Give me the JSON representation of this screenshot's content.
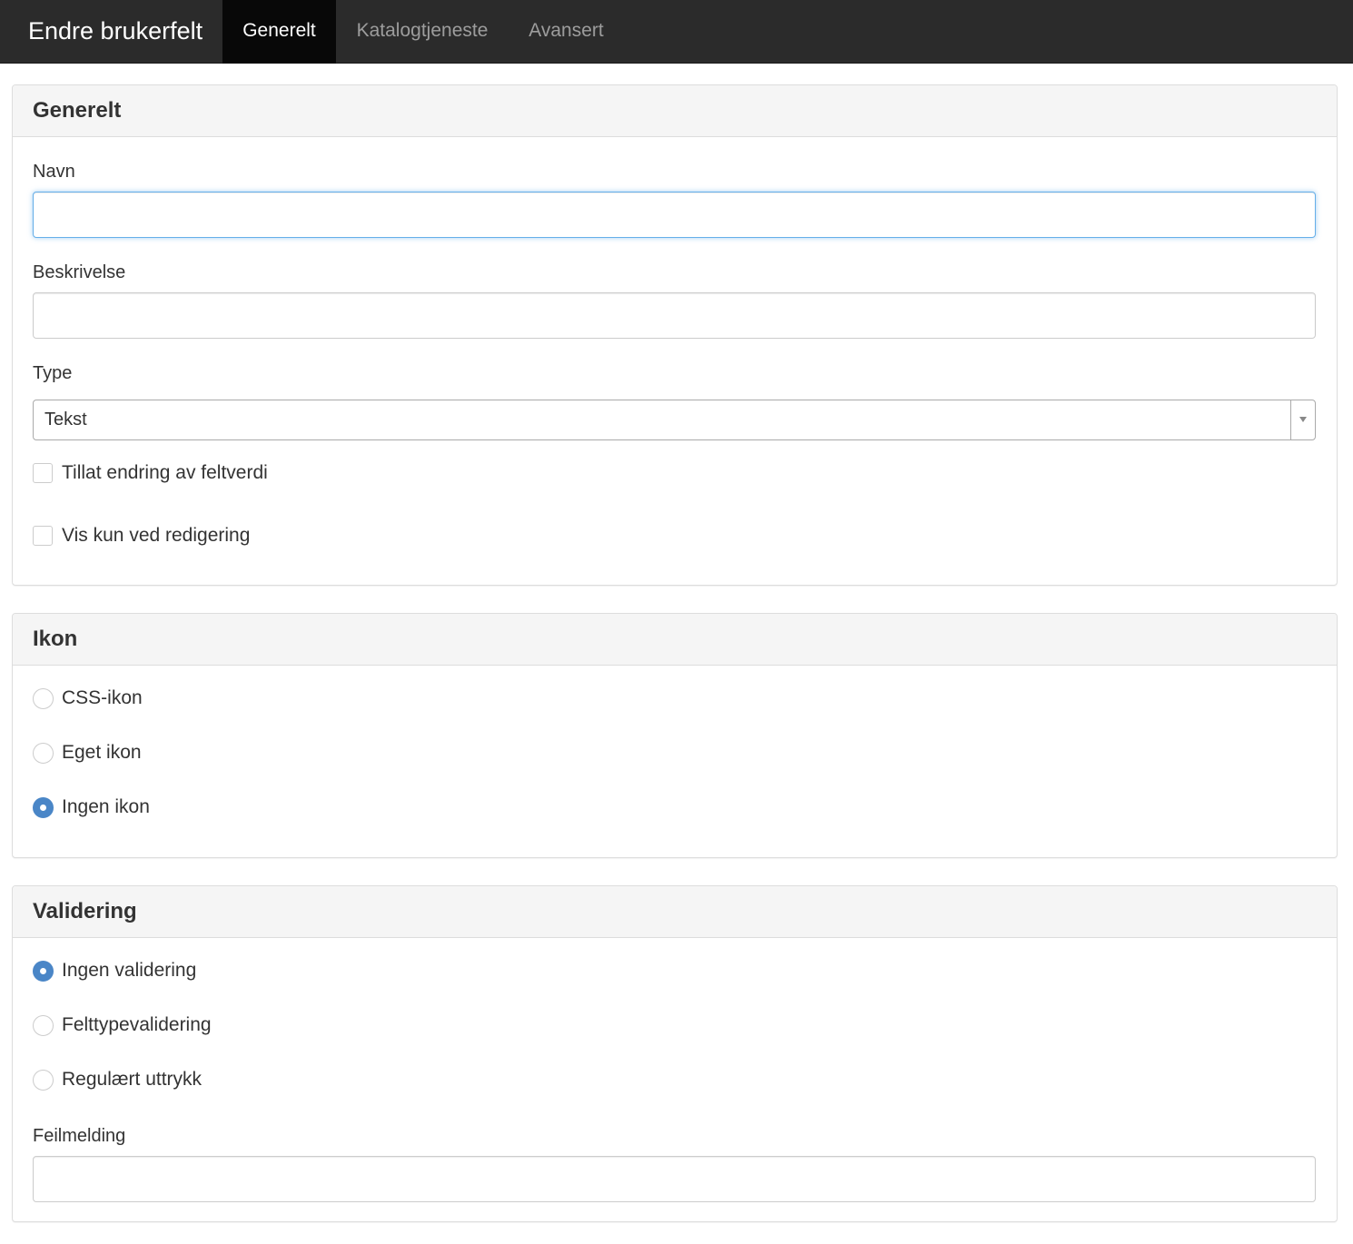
{
  "navbar": {
    "brand": "Endre brukerfelt",
    "tabs": [
      {
        "label": "Generelt",
        "active": true
      },
      {
        "label": "Katalogtjeneste",
        "active": false
      },
      {
        "label": "Avansert",
        "active": false
      }
    ]
  },
  "general": {
    "heading": "Generelt",
    "name_label": "Navn",
    "name_value": "",
    "description_label": "Beskrivelse",
    "description_value": "",
    "type_label": "Type",
    "type_value": "Tekst",
    "allow_edit_label": "Tillat endring av feltverdi",
    "allow_edit_checked": false,
    "show_only_edit_label": "Vis kun ved redigering",
    "show_only_edit_checked": false
  },
  "icon": {
    "heading": "Ikon",
    "options": [
      {
        "label": "CSS-ikon",
        "checked": false
      },
      {
        "label": "Eget ikon",
        "checked": false
      },
      {
        "label": "Ingen ikon",
        "checked": true
      }
    ]
  },
  "validation": {
    "heading": "Validering",
    "options": [
      {
        "label": "Ingen validering",
        "checked": true
      },
      {
        "label": "Felttypevalidering",
        "checked": false
      },
      {
        "label": "Regulært uttrykk",
        "checked": false
      }
    ],
    "error_label": "Feilmelding",
    "error_value": ""
  },
  "colors": {
    "navbar_bg": "#2b2b2b",
    "active_tab_bg": "#080808",
    "radio_checked": "#4a86c7",
    "focus_border": "#66afe9"
  }
}
